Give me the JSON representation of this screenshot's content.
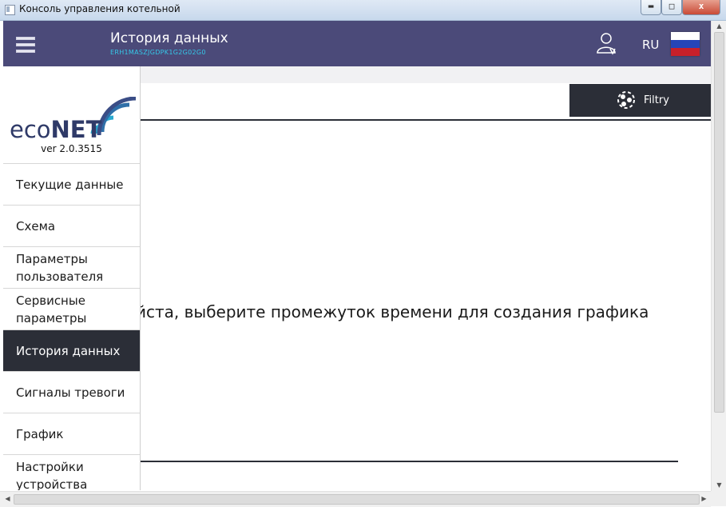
{
  "window": {
    "title": "Консоль управления котельной",
    "min_label": "▬",
    "max_label": "□",
    "close_label": "x"
  },
  "header": {
    "title": "История данных",
    "device_id": "ERH1MASZJGDPK1G2G02G0",
    "language": "RU",
    "menu_icon": "hamburger-icon",
    "user_icon": "user-settings-icon",
    "flag_icon": "russia-flag-icon"
  },
  "sidebar": {
    "logo_text_light": "eco",
    "logo_text_bold": "NET",
    "version": "ver 2.0.3515",
    "items": [
      {
        "label": "Текущие данные"
      },
      {
        "label": "Схема"
      },
      {
        "label": "Параметры пользователя"
      },
      {
        "label": "Сервисные параметры"
      },
      {
        "label": "История данных"
      },
      {
        "label": "Сигналы тревоги"
      },
      {
        "label": "График"
      },
      {
        "label": "Настройки устройства"
      }
    ],
    "active_index": 4
  },
  "main": {
    "filter_label": "Filtry",
    "message": "йста, выберите промежуток времени для создания графика"
  },
  "colors": {
    "header_bg": "#4b4a79",
    "accent_cyan": "#35c8e8",
    "dark": "#2b2e37"
  }
}
